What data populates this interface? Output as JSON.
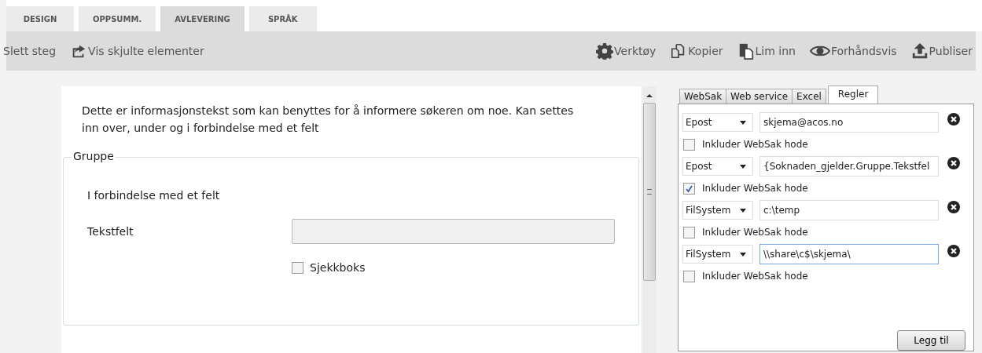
{
  "tabs": [
    {
      "label": "DESIGN",
      "selected": false
    },
    {
      "label": "OPPSUMM.",
      "selected": false
    },
    {
      "label": "AVLEVERING",
      "selected": true
    },
    {
      "label": "SPRÅK",
      "selected": false
    }
  ],
  "toolbar": {
    "left": [
      {
        "label": "Slett steg",
        "kind": "text"
      },
      {
        "label": "Vis skjulte elementer",
        "kind": "share"
      }
    ],
    "right": [
      {
        "label": "Verktøy",
        "kind": "gear"
      },
      {
        "label": "Kopier",
        "kind": "copy"
      },
      {
        "label": "Lim inn",
        "kind": "paste"
      },
      {
        "label": "Forhåndsvis",
        "kind": "eye"
      },
      {
        "label": "Publiser",
        "kind": "upload"
      }
    ]
  },
  "form": {
    "info_text": "Dette er informasjonstekst som kan benyttes for å informere søkeren om noe. Kan settes inn over, under og i forbindelse med et felt",
    "group": {
      "title": "Gruppe",
      "text": "I forbindelse med et felt",
      "field_label": "Tekstfelt",
      "checkbox": {
        "label": "Sjekkboks",
        "checked": false
      }
    }
  },
  "rules_panel": {
    "tabs": [
      {
        "label": "WebSak",
        "selected": false
      },
      {
        "label": "Web service",
        "selected": false
      },
      {
        "label": "Excel",
        "selected": false
      },
      {
        "label": "Regler",
        "selected": true
      }
    ],
    "rules": [
      {
        "type": "Epost",
        "value": "skjema@acos.no",
        "include_label": "Inkluder WebSak hode",
        "checked": false,
        "focused": false
      },
      {
        "type": "Epost",
        "value": "{Soknaden_gjelder.Gruppe.Tekstfel",
        "include_label": "Inkluder WebSak hode",
        "checked": true,
        "focused": false
      },
      {
        "type": "FilSystem",
        "value": "c:\\temp",
        "include_label": "Inkluder WebSak hode",
        "checked": false,
        "focused": false
      },
      {
        "type": "FilSystem",
        "value": "\\\\share\\c$\\skjema\\",
        "include_label": "Inkluder WebSak hode",
        "checked": false,
        "focused": true
      }
    ],
    "add_button": "Legg til"
  }
}
